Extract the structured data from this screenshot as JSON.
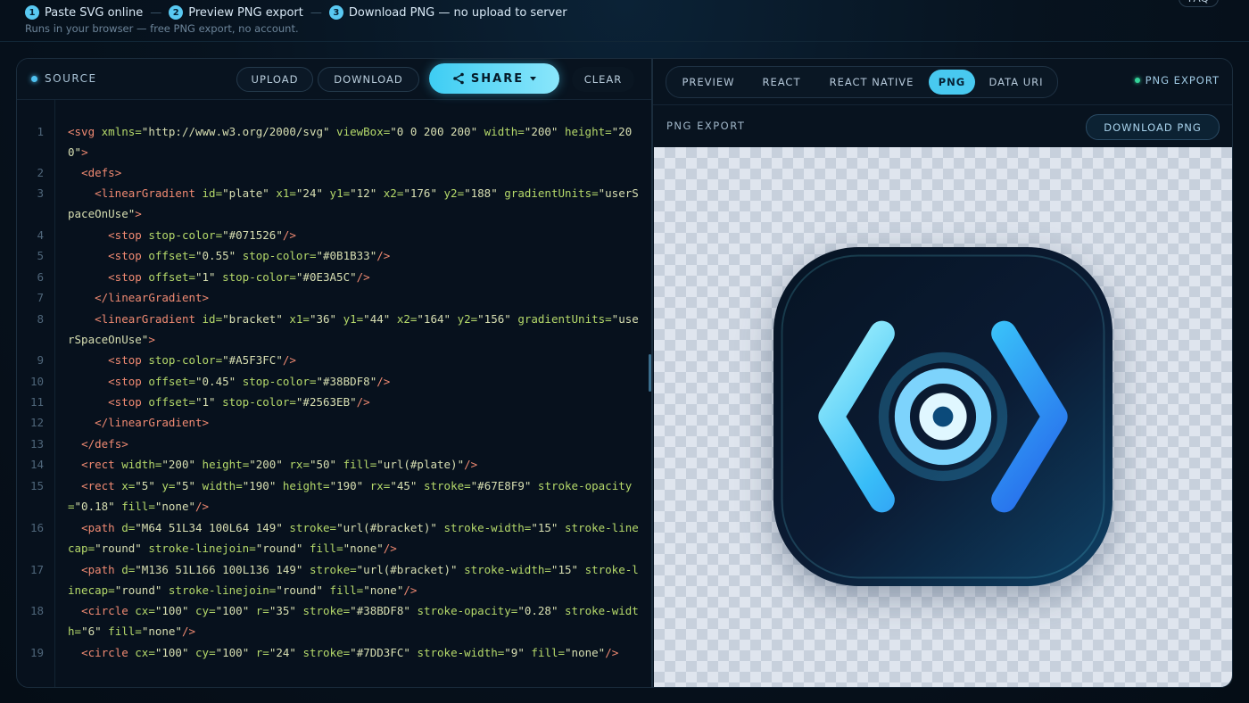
{
  "steps": [
    {
      "num": "1",
      "label": "Paste SVG online"
    },
    {
      "num": "2",
      "label": "Preview PNG export"
    },
    {
      "num": "3",
      "label": "Download PNG — no upload to server"
    }
  ],
  "subtitle": "Runs in your browser — free PNG export, no account.",
  "header_right": {
    "faq": "FAQ"
  },
  "source": {
    "label": "SOURCE",
    "buttons": {
      "upload": "UPLOAD",
      "download": "DOWNLOAD",
      "share": "SHARE",
      "clear": "CLEAR"
    },
    "lines": [
      {
        "n": "1",
        "tokens": [
          [
            "t",
            "<svg "
          ],
          [
            "a",
            "xmlns="
          ],
          [
            "s",
            "\"http://www.w3.org/2000/svg\""
          ],
          [
            "p",
            " "
          ],
          [
            "a",
            "viewBox="
          ],
          [
            "s",
            "\"0 0 200 200\""
          ],
          [
            "p",
            " "
          ],
          [
            "a",
            "width="
          ],
          [
            "s",
            "\"200\""
          ],
          [
            "p",
            " "
          ],
          [
            "a",
            "height="
          ],
          [
            "s",
            "\"200\""
          ],
          [
            "t",
            ">"
          ]
        ]
      },
      {
        "n": "2",
        "tokens": [
          [
            "p",
            "  "
          ],
          [
            "t",
            "<defs>"
          ]
        ]
      },
      {
        "n": "3",
        "tokens": [
          [
            "p",
            "    "
          ],
          [
            "t",
            "<linearGradient "
          ],
          [
            "a",
            "id="
          ],
          [
            "s",
            "\"plate\""
          ],
          [
            "p",
            " "
          ],
          [
            "a",
            "x1="
          ],
          [
            "s",
            "\"24\""
          ],
          [
            "p",
            " "
          ],
          [
            "a",
            "y1="
          ],
          [
            "s",
            "\"12\""
          ],
          [
            "p",
            " "
          ],
          [
            "a",
            "x2="
          ],
          [
            "s",
            "\"176\""
          ],
          [
            "p",
            " "
          ],
          [
            "a",
            "y2="
          ],
          [
            "s",
            "\"188\""
          ],
          [
            "p",
            " "
          ],
          [
            "a",
            "gradientUnits="
          ],
          [
            "s",
            "\"userSpaceOnUse\""
          ],
          [
            "t",
            ">"
          ]
        ]
      },
      {
        "n": "4",
        "tokens": [
          [
            "p",
            "      "
          ],
          [
            "t",
            "<stop "
          ],
          [
            "a",
            "stop-color="
          ],
          [
            "s",
            "\"#071526\""
          ],
          [
            "t",
            "/>"
          ]
        ]
      },
      {
        "n": "5",
        "tokens": [
          [
            "p",
            "      "
          ],
          [
            "t",
            "<stop "
          ],
          [
            "a",
            "offset="
          ],
          [
            "s",
            "\"0.55\""
          ],
          [
            "p",
            " "
          ],
          [
            "a",
            "stop-color="
          ],
          [
            "s",
            "\"#0B1B33\""
          ],
          [
            "t",
            "/>"
          ]
        ]
      },
      {
        "n": "6",
        "tokens": [
          [
            "p",
            "      "
          ],
          [
            "t",
            "<stop "
          ],
          [
            "a",
            "offset="
          ],
          [
            "s",
            "\"1\""
          ],
          [
            "p",
            " "
          ],
          [
            "a",
            "stop-color="
          ],
          [
            "s",
            "\"#0E3A5C\""
          ],
          [
            "t",
            "/>"
          ]
        ]
      },
      {
        "n": "7",
        "tokens": [
          [
            "p",
            "    "
          ],
          [
            "t",
            "</linearGradient>"
          ]
        ]
      },
      {
        "n": "8",
        "tokens": [
          [
            "p",
            "    "
          ],
          [
            "t",
            "<linearGradient "
          ],
          [
            "a",
            "id="
          ],
          [
            "s",
            "\"bracket\""
          ],
          [
            "p",
            " "
          ],
          [
            "a",
            "x1="
          ],
          [
            "s",
            "\"36\""
          ],
          [
            "p",
            " "
          ],
          [
            "a",
            "y1="
          ],
          [
            "s",
            "\"44\""
          ],
          [
            "p",
            " "
          ],
          [
            "a",
            "x2="
          ],
          [
            "s",
            "\"164\""
          ],
          [
            "p",
            " "
          ],
          [
            "a",
            "y2="
          ],
          [
            "s",
            "\"156\""
          ],
          [
            "p",
            " "
          ],
          [
            "a",
            "gradientUnits="
          ],
          [
            "s",
            "\"userSpaceOnUse\""
          ],
          [
            "t",
            ">"
          ]
        ]
      },
      {
        "n": "9",
        "tokens": [
          [
            "p",
            "      "
          ],
          [
            "t",
            "<stop "
          ],
          [
            "a",
            "stop-color="
          ],
          [
            "s",
            "\"#A5F3FC\""
          ],
          [
            "t",
            "/>"
          ]
        ]
      },
      {
        "n": "10",
        "tokens": [
          [
            "p",
            "      "
          ],
          [
            "t",
            "<stop "
          ],
          [
            "a",
            "offset="
          ],
          [
            "s",
            "\"0.45\""
          ],
          [
            "p",
            " "
          ],
          [
            "a",
            "stop-color="
          ],
          [
            "s",
            "\"#38BDF8\""
          ],
          [
            "t",
            "/>"
          ]
        ]
      },
      {
        "n": "11",
        "tokens": [
          [
            "p",
            "      "
          ],
          [
            "t",
            "<stop "
          ],
          [
            "a",
            "offset="
          ],
          [
            "s",
            "\"1\""
          ],
          [
            "p",
            " "
          ],
          [
            "a",
            "stop-color="
          ],
          [
            "s",
            "\"#2563EB\""
          ],
          [
            "t",
            "/>"
          ]
        ]
      },
      {
        "n": "12",
        "tokens": [
          [
            "p",
            "    "
          ],
          [
            "t",
            "</linearGradient>"
          ]
        ]
      },
      {
        "n": "13",
        "tokens": [
          [
            "p",
            "  "
          ],
          [
            "t",
            "</defs>"
          ]
        ]
      },
      {
        "n": "14",
        "tokens": [
          [
            "p",
            "  "
          ],
          [
            "t",
            "<rect "
          ],
          [
            "a",
            "width="
          ],
          [
            "s",
            "\"200\""
          ],
          [
            "p",
            " "
          ],
          [
            "a",
            "height="
          ],
          [
            "s",
            "\"200\""
          ],
          [
            "p",
            " "
          ],
          [
            "a",
            "rx="
          ],
          [
            "s",
            "\"50\""
          ],
          [
            "p",
            " "
          ],
          [
            "a",
            "fill="
          ],
          [
            "s",
            "\"url(#plate)\""
          ],
          [
            "t",
            "/>"
          ]
        ]
      },
      {
        "n": "15",
        "tokens": [
          [
            "p",
            "  "
          ],
          [
            "t",
            "<rect "
          ],
          [
            "a",
            "x="
          ],
          [
            "s",
            "\"5\""
          ],
          [
            "p",
            " "
          ],
          [
            "a",
            "y="
          ],
          [
            "s",
            "\"5\""
          ],
          [
            "p",
            " "
          ],
          [
            "a",
            "width="
          ],
          [
            "s",
            "\"190\""
          ],
          [
            "p",
            " "
          ],
          [
            "a",
            "height="
          ],
          [
            "s",
            "\"190\""
          ],
          [
            "p",
            " "
          ],
          [
            "a",
            "rx="
          ],
          [
            "s",
            "\"45\""
          ],
          [
            "p",
            " "
          ],
          [
            "a",
            "stroke="
          ],
          [
            "s",
            "\"#67E8F9\""
          ],
          [
            "p",
            " "
          ],
          [
            "a",
            "stroke-opacity="
          ],
          [
            "s",
            "\"0.18\""
          ],
          [
            "p",
            " "
          ],
          [
            "a",
            "fill="
          ],
          [
            "s",
            "\"none\""
          ],
          [
            "t",
            "/>"
          ]
        ]
      },
      {
        "n": "16",
        "tokens": [
          [
            "p",
            "  "
          ],
          [
            "t",
            "<path "
          ],
          [
            "a",
            "d="
          ],
          [
            "s",
            "\"M64 51L34 100L64 149\""
          ],
          [
            "p",
            " "
          ],
          [
            "a",
            "stroke="
          ],
          [
            "s",
            "\"url(#bracket)\""
          ],
          [
            "p",
            " "
          ],
          [
            "a",
            "stroke-width="
          ],
          [
            "s",
            "\"15\""
          ],
          [
            "p",
            " "
          ],
          [
            "a",
            "stroke-linecap="
          ],
          [
            "s",
            "\"round\""
          ],
          [
            "p",
            " "
          ],
          [
            "a",
            "stroke-linejoin="
          ],
          [
            "s",
            "\"round\""
          ],
          [
            "p",
            " "
          ],
          [
            "a",
            "fill="
          ],
          [
            "s",
            "\"none\""
          ],
          [
            "t",
            "/>"
          ]
        ]
      },
      {
        "n": "17",
        "tokens": [
          [
            "p",
            "  "
          ],
          [
            "t",
            "<path "
          ],
          [
            "a",
            "d="
          ],
          [
            "s",
            "\"M136 51L166 100L136 149\""
          ],
          [
            "p",
            " "
          ],
          [
            "a",
            "stroke="
          ],
          [
            "s",
            "\"url(#bracket)\""
          ],
          [
            "p",
            " "
          ],
          [
            "a",
            "stroke-width="
          ],
          [
            "s",
            "\"15\""
          ],
          [
            "p",
            " "
          ],
          [
            "a",
            "stroke-linecap="
          ],
          [
            "s",
            "\"round\""
          ],
          [
            "p",
            " "
          ],
          [
            "a",
            "stroke-linejoin="
          ],
          [
            "s",
            "\"round\""
          ],
          [
            "p",
            " "
          ],
          [
            "a",
            "fill="
          ],
          [
            "s",
            "\"none\""
          ],
          [
            "t",
            "/>"
          ]
        ]
      },
      {
        "n": "18",
        "tokens": [
          [
            "p",
            "  "
          ],
          [
            "t",
            "<circle "
          ],
          [
            "a",
            "cx="
          ],
          [
            "s",
            "\"100\""
          ],
          [
            "p",
            " "
          ],
          [
            "a",
            "cy="
          ],
          [
            "s",
            "\"100\""
          ],
          [
            "p",
            " "
          ],
          [
            "a",
            "r="
          ],
          [
            "s",
            "\"35\""
          ],
          [
            "p",
            " "
          ],
          [
            "a",
            "stroke="
          ],
          [
            "s",
            "\"#38BDF8\""
          ],
          [
            "p",
            " "
          ],
          [
            "a",
            "stroke-opacity="
          ],
          [
            "s",
            "\"0.28\""
          ],
          [
            "p",
            " "
          ],
          [
            "a",
            "stroke-width="
          ],
          [
            "s",
            "\"6\""
          ],
          [
            "p",
            " "
          ],
          [
            "a",
            "fill="
          ],
          [
            "s",
            "\"none\""
          ],
          [
            "t",
            "/>"
          ]
        ]
      },
      {
        "n": "19",
        "tokens": [
          [
            "p",
            "  "
          ],
          [
            "t",
            "<circle "
          ],
          [
            "a",
            "cx="
          ],
          [
            "s",
            "\"100\""
          ],
          [
            "p",
            " "
          ],
          [
            "a",
            "cy="
          ],
          [
            "s",
            "\"100\""
          ],
          [
            "p",
            " "
          ],
          [
            "a",
            "r="
          ],
          [
            "s",
            "\"24\""
          ],
          [
            "p",
            " "
          ],
          [
            "a",
            "stroke="
          ],
          [
            "s",
            "\"#7DD3FC\""
          ],
          [
            "p",
            " "
          ],
          [
            "a",
            "stroke-width="
          ],
          [
            "s",
            "\"9\""
          ],
          [
            "p",
            " "
          ],
          [
            "a",
            "fill="
          ],
          [
            "s",
            "\"none\""
          ],
          [
            "t",
            "/>"
          ]
        ]
      }
    ]
  },
  "preview": {
    "tabs": [
      {
        "label": "PREVIEW",
        "active": false
      },
      {
        "label": "REACT",
        "active": false
      },
      {
        "label": "REACT NATIVE",
        "active": false
      },
      {
        "label": "PNG",
        "active": true
      },
      {
        "label": "DATA URI",
        "active": false
      }
    ],
    "status": "PNG EXPORT",
    "section_title": "PNG EXPORT",
    "download_png": "DOWNLOAD PNG"
  },
  "colors": {
    "accent": "#48C9F0",
    "status_dot": "#34D399",
    "plate_stops": [
      "#071526",
      "#0B1B33",
      "#0E3A5C"
    ],
    "bracket_stops": [
      "#A5F3FC",
      "#38BDF8",
      "#2563EB"
    ],
    "plate_border": "#67E8F9",
    "ring_outer": "#38BDF8",
    "ring_inner": "#7DD3FC"
  },
  "icons": [
    "share-icon",
    "chevron-down-icon",
    "code-bracket-logo"
  ]
}
